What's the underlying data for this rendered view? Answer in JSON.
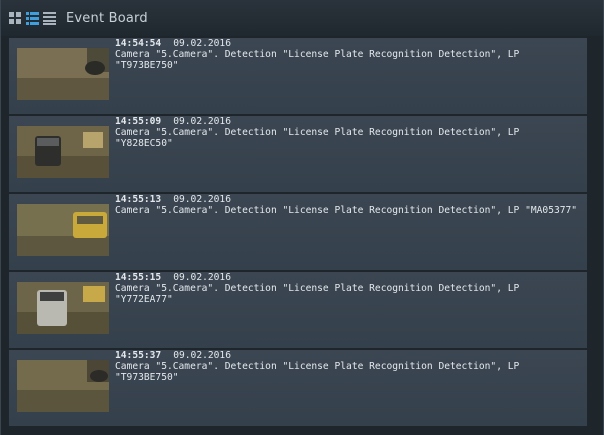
{
  "window": {
    "title": "Event Board"
  },
  "toolbar": {
    "icons": [
      "grid-view-icon",
      "list-view-icon",
      "text-view-icon"
    ]
  },
  "events": [
    {
      "time": "14:54:54",
      "date": "09.02.2016",
      "text": "Camera \"5.Camera\". Detection \"License Plate Recognition Detection\", LP \"T973BE750\""
    },
    {
      "time": "14:55:09",
      "date": "09.02.2016",
      "text": "Camera \"5.Camera\". Detection \"License Plate Recognition Detection\", LP \"Y828EC50\""
    },
    {
      "time": "14:55:13",
      "date": "09.02.2016",
      "text": "Camera \"5.Camera\". Detection \"License Plate Recognition Detection\", LP \"MA05377\""
    },
    {
      "time": "14:55:15",
      "date": "09.02.2016",
      "text": "Camera \"5.Camera\". Detection \"License Plate Recognition Detection\", LP \"Y772EA77\""
    },
    {
      "time": "14:55:37",
      "date": "09.02.2016",
      "text": "Camera \"5.Camera\". Detection \"License Plate Recognition Detection\", LP \"T973BE750\""
    }
  ],
  "colors": {
    "background": "#1e252b",
    "row": "#3a4551",
    "text": "#e4e8ec",
    "accent": "#3fa0e0"
  }
}
